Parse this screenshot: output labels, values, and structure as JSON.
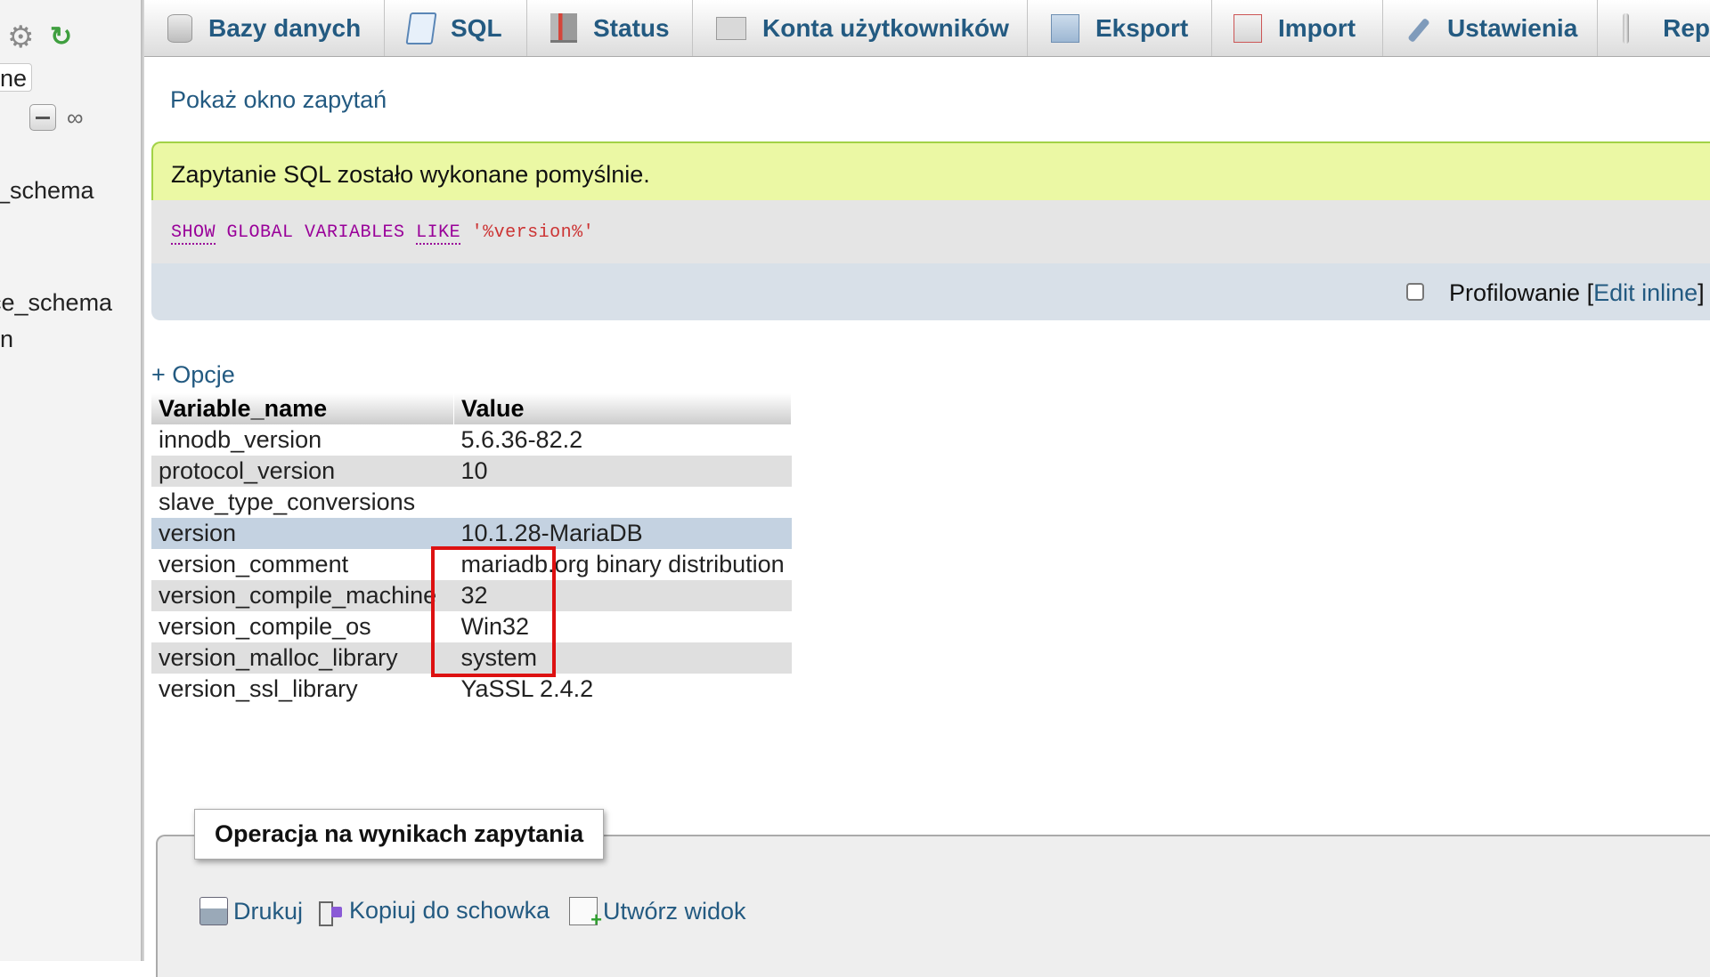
{
  "nav": {
    "filter_value": "ne",
    "items": [
      {
        "label": "_schema"
      },
      {
        "label": "ce_schema"
      },
      {
        "label": "in"
      }
    ]
  },
  "tabs": [
    {
      "label": "Bazy danych",
      "icon": "database-icon"
    },
    {
      "label": "SQL",
      "icon": "sql-icon"
    },
    {
      "label": "Status",
      "icon": "status-icon"
    },
    {
      "label": "Konta użytkowników",
      "icon": "user-accounts-icon"
    },
    {
      "label": "Eksport",
      "icon": "export-icon"
    },
    {
      "label": "Import",
      "icon": "import-icon"
    },
    {
      "label": "Ustawienia",
      "icon": "wrench-icon"
    },
    {
      "label": "Rep",
      "icon": "replication-icon"
    }
  ],
  "main": {
    "show_query_link": "Pokaż okno zapytań",
    "success_message": "Zapytanie SQL zostało wykonane pomyślnie.",
    "sql": {
      "kw1": "SHOW",
      "kw2": "GLOBAL VARIABLES",
      "kw3": "LIKE",
      "str": "'%version%'"
    },
    "profiling": {
      "checked": false,
      "label": "Profilowanie [",
      "edit_inline": "Edit inline",
      "close": "]"
    },
    "options_link": "+ Opcje"
  },
  "table": {
    "headers": [
      "Variable_name",
      "Value"
    ],
    "rows": [
      {
        "name": "innodb_version",
        "value": "5.6.36-82.2"
      },
      {
        "name": "protocol_version",
        "value": "10"
      },
      {
        "name": "slave_type_conversions",
        "value": ""
      },
      {
        "name": "version",
        "value": "10.1.28-MariaDB"
      },
      {
        "name": "version_comment",
        "value": "mariadb.org binary distribution"
      },
      {
        "name": "version_compile_machine",
        "value": "32"
      },
      {
        "name": "version_compile_os",
        "value": "Win32"
      },
      {
        "name": "version_malloc_library",
        "value": "system"
      },
      {
        "name": "version_ssl_library",
        "value": "YaSSL 2.4.2"
      }
    ]
  },
  "operations": {
    "legend": "Operacja na wynikach zapytania",
    "print": "Drukuj",
    "copy": "Kopiuj do schowka",
    "create_view": "Utwórz widok"
  },
  "colors": {
    "link": "#235a81",
    "success_bg": "#ebf8a4",
    "highlight_box": "#dd1111",
    "marked_row": "#c4d2e1"
  }
}
